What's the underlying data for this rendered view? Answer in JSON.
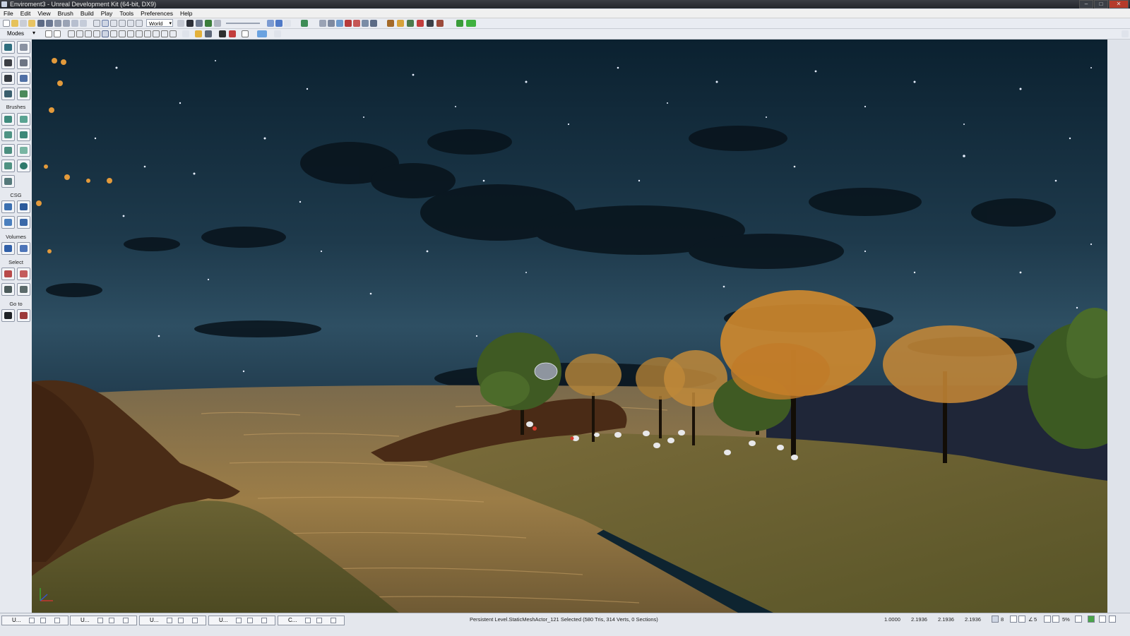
{
  "window": {
    "title": "Enviroment3 - Unreal Development Kit (64-bit, DX9)",
    "controls": [
      "–",
      "□",
      "✕"
    ]
  },
  "menubar": {
    "items": [
      "File",
      "Edit",
      "View",
      "Brush",
      "Build",
      "Play",
      "Tools",
      "Preferences",
      "Help"
    ]
  },
  "toolbar": {
    "coord_system": "World",
    "modes_label": "Modes",
    "play_color": "#3fb13f"
  },
  "sidebar": {
    "sections": {
      "brushes": "Brushes",
      "csg": "CSG",
      "volumes": "Volumes",
      "select": "Select",
      "goto": "Go to"
    },
    "tool_icons": [
      "camera-mode-icon",
      "geometry-mode-icon",
      "terrain-mode-icon",
      "translate-icon",
      "texture-align-icon",
      "mesh-paint-icon",
      "landscape-icon",
      "foliage-icon",
      "cube-brush-icon",
      "cone-brush-icon",
      "curved-stair-icon",
      "cylinder-brush-icon",
      "linear-stair-icon",
      "sheet-brush-icon",
      "spiral-stair-icon",
      "sphere-brush-icon",
      "volumetric-brush-icon",
      "csg-add-icon",
      "csg-subtract-icon",
      "csg-intersect-icon",
      "csg-deintersect-icon",
      "add-volume-icon",
      "volume-list-icon",
      "show-selected-icon",
      "hide-selected-icon",
      "invert-selection-icon",
      "show-all-icon",
      "go-to-actor-icon",
      "go-to-builder-brush-icon"
    ]
  },
  "taskbar": {
    "windows": [
      "U...",
      "U...",
      "U...",
      "U...",
      "C..."
    ]
  },
  "status": {
    "selection_text": "Persistent Level.StaticMeshActor_121 Selected (580 Tris, 314 Verts, 0 Sections)",
    "drag_grid": "1.0000",
    "coord_x": "2.1936",
    "coord_y": "2.1936",
    "coord_z": "2.1936",
    "grid_size": "8",
    "rotation_snap": "5",
    "scale_snap": "5%"
  },
  "colors": {
    "sky_top": "#0b2130",
    "sky_horizon": "#2e4f63",
    "water": "#9c7d47",
    "grass": "#6a6233",
    "cliff": "#4a2c16",
    "autumn_leaves": "#e39a3b"
  }
}
